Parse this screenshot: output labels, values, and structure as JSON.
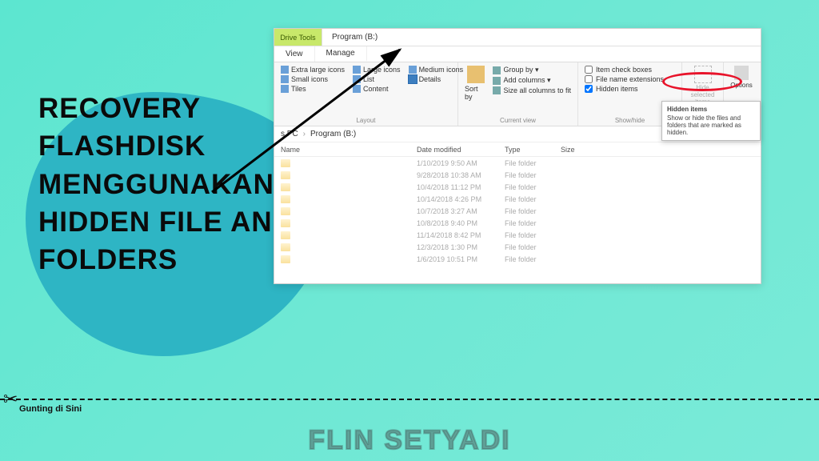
{
  "headline": "RECOVERY FLASHDISK MENGGUNAKAN HIDDEN FILE AND FOLDERS",
  "cut_label": "Gunting di Sini",
  "watermark": "FLIN SETYADI",
  "explorer": {
    "drive_tools": "Drive Tools",
    "program_tab": "Program (B:)",
    "tab_view": "View",
    "tab_manage": "Manage",
    "ribbon": {
      "layout_group": "Layout",
      "extra_large": "Extra large icons",
      "large": "Large icons",
      "medium": "Medium icons",
      "small": "Small icons",
      "list": "List",
      "details": "Details",
      "tiles": "Tiles",
      "content": "Content",
      "sort_by": "Sort by",
      "current_view_group": "Current view",
      "group_by": "Group by ▾",
      "add_columns": "Add columns ▾",
      "size_all": "Size all columns to fit",
      "show_hide_group": "Show/hide",
      "item_check": "Item check boxes",
      "file_ext": "File name extensions",
      "hidden_items": "Hidden items",
      "hide_selected": "Hide selected items",
      "options": "Options"
    },
    "breadcrumb": {
      "pc": "s PC",
      "prog": "Program (B:)"
    },
    "columns": {
      "name": "Name",
      "date": "Date modified",
      "type": "Type",
      "size": "Size"
    },
    "files": [
      {
        "date": "1/10/2019 9:50 AM",
        "type": "File folder"
      },
      {
        "date": "9/28/2018 10:38 AM",
        "type": "File folder"
      },
      {
        "date": "10/4/2018 11:12 PM",
        "type": "File folder"
      },
      {
        "date": "10/14/2018 4:26 PM",
        "type": "File folder"
      },
      {
        "date": "10/7/2018 3:27 AM",
        "type": "File folder"
      },
      {
        "date": "10/8/2018 9:40 PM",
        "type": "File folder"
      },
      {
        "date": "11/14/2018 8:42 PM",
        "type": "File folder"
      },
      {
        "date": "12/3/2018 1:30 PM",
        "type": "File folder"
      },
      {
        "date": "1/6/2019 10:51 PM",
        "type": "File folder"
      }
    ],
    "tooltip": {
      "title": "Hidden items",
      "body": "Show or hide the files and folders that are marked as hidden."
    }
  }
}
